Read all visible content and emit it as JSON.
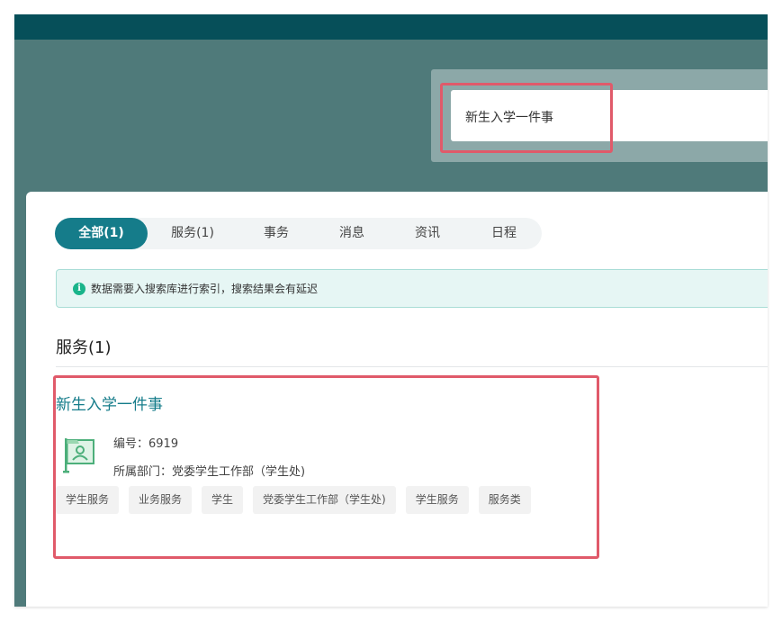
{
  "search": {
    "value": "新生入学一件事"
  },
  "tabs": [
    {
      "label": "全部(1)",
      "active": true
    },
    {
      "label": "服务(1)",
      "active": false
    },
    {
      "label": "事务",
      "active": false
    },
    {
      "label": "消息",
      "active": false
    },
    {
      "label": "资讯",
      "active": false
    },
    {
      "label": "日程",
      "active": false
    }
  ],
  "notice": {
    "icon": "info-icon",
    "icon_glyph": "i",
    "text": "数据需要入搜索库进行索引，搜索结果会有延迟"
  },
  "section": {
    "title": "服务(1)"
  },
  "result": {
    "title": "新生入学一件事",
    "icon": "service-flag-icon",
    "number_label": "编号：",
    "number_value": "6919",
    "dept_label": "所属部门：",
    "dept_value": "党委学生工作部（学生处)",
    "tags": [
      "学生服务",
      "业务服务",
      "学生",
      "党委学生工作部（学生处)",
      "学生服务",
      "服务类"
    ]
  },
  "colors": {
    "accent": "#157c8a",
    "highlight": "#e05a6a",
    "header": "#064f59",
    "banner": "#4f7a7a"
  }
}
